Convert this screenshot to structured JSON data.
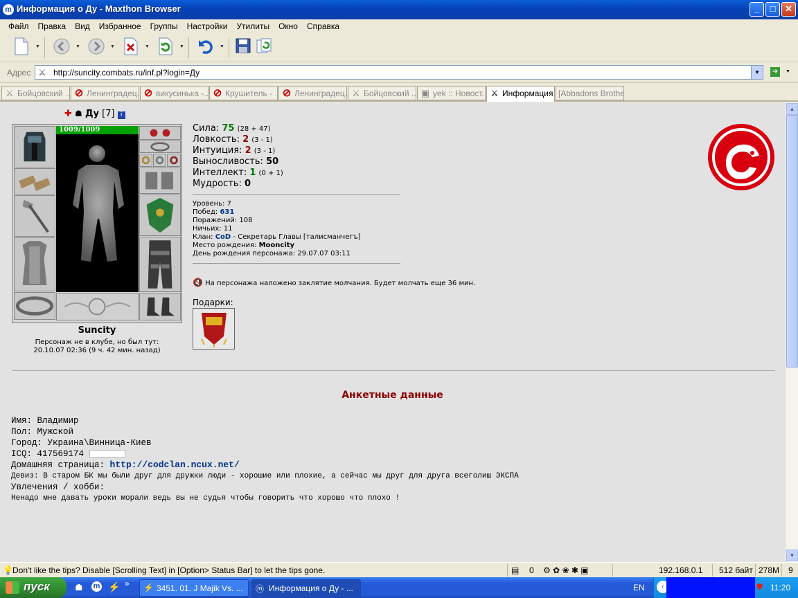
{
  "window": {
    "title": "Информация о Ду - Maxthon Browser",
    "buttons": {
      "minimize": "_",
      "maximize": "□",
      "close": "✕"
    }
  },
  "menu": [
    "Файл",
    "Правка",
    "Вид",
    "Избранное",
    "Группы",
    "Настройки",
    "Утилиты",
    "Окно",
    "Справка"
  ],
  "toolbar": {
    "icons": [
      "new-page-icon",
      "back-icon",
      "forward-icon",
      "stop-icon",
      "refresh-icon",
      "undo-icon",
      "save-icon",
      "sync-icon"
    ]
  },
  "address": {
    "label": "Адрес",
    "url": "http://suncity.combats.ru/inf.pl?login=Ду"
  },
  "tabs": [
    {
      "label": "Бойцовский ...",
      "icon": "swords-icon"
    },
    {
      "label": "Ленинградец...",
      "icon": "no-entry-icon"
    },
    {
      "label": "викусинька -...",
      "icon": "no-entry-icon"
    },
    {
      "label": "Крушитель - ...",
      "icon": "no-entry-icon"
    },
    {
      "label": "Ленинградец...",
      "icon": "no-entry-icon"
    },
    {
      "label": "Бойцовский ...",
      "icon": "swords-icon"
    },
    {
      "label": "yek :: Новост...",
      "icon": "page-icon"
    },
    {
      "label": "Информация...",
      "icon": "swords-icon",
      "active": true
    },
    {
      "label": "[Abbadons Brothe...",
      "icon": "none"
    }
  ],
  "profile": {
    "name": "Ду",
    "level_badge": "[7]",
    "hp": "1009/1009",
    "hp_fraction": 1.0,
    "city": "Suncity",
    "last_seen_line1": "Персонаж не в клубе, но был тут:",
    "last_seen_line2": "20.10.07 02:36 (9 ч. 42 мин. назад)",
    "stats": [
      {
        "label": "Сила:",
        "value": "75",
        "detail": "(28 + 47)",
        "color": "#007700"
      },
      {
        "label": "Ловкость:",
        "value": "2",
        "detail": "(3 - 1)",
        "color": "#8b0000"
      },
      {
        "label": "Интуиция:",
        "value": "2",
        "detail": "(3 - 1)",
        "color": "#8b0000"
      },
      {
        "label": "Выносливость:",
        "value": "50",
        "detail": "",
        "color": "#000000"
      },
      {
        "label": "Интеллект:",
        "value": "1",
        "detail": "(0 + 1)",
        "color": "#007700"
      },
      {
        "label": "Мудрость:",
        "value": "0",
        "detail": "",
        "color": "#000000"
      }
    ],
    "info": {
      "level_label": "Уровень:",
      "level": "7",
      "wins_label": "Побед:",
      "wins": "631",
      "losses_label": "Поражений:",
      "losses": "108",
      "draws_label": "Ничьих:",
      "draws": "11",
      "clan_label": "Клан:",
      "clan": "CoD",
      "clan_role": "- Секретарь Главы [талисманчегъ]",
      "birthplace_label": "Место рождения:",
      "birthplace": "Mooncity",
      "birthday_label": "День рождения персонажа:",
      "birthday": "29.07.07 03:11"
    },
    "silence_notice": "На персонажа наложено заклятие молчания. Будет молчать еще 36 мин.",
    "gifts_label": "Подарки:"
  },
  "questionnaire": {
    "heading": "Анкетные данные",
    "name": "Имя: Владимир",
    "gender": "Пол: Мужской",
    "city": "Город: Украина\\Винница-Киев",
    "icq": "ICQ: 417569174",
    "homepage_label": "Домашняя страница:",
    "homepage": "http://codclan.ncux.net/",
    "motto": "Девиз: В старом БК мы были друг для дружки люди - хорошие или плохие, а сейчас мы друг для друга всеголиш ЭКСПА",
    "hobbies_label": "Увлечения / хобби:",
    "hobbies": "Ненадо мне давать уроки морали ведь вы не судья чтобы говорить что хорошо что плохо !"
  },
  "status": {
    "tip": "Don't like the tips? Disable [Scrolling Text] in [Option> Status Bar] to let the tips gone.",
    "count": "0",
    "ip": "192.168.0.1",
    "bytes": "512 байт",
    "memory": "278M",
    "tabs_count": "9"
  },
  "taskbar": {
    "start": "пуск",
    "items": [
      {
        "label": "3451. 01. J Majik Vs. ..."
      },
      {
        "label": "Информация о Ду - ...",
        "active": true
      }
    ],
    "lang": "EN",
    "clock": "11:20"
  },
  "colors": {
    "link_blue": "#003388",
    "heading_red": "#8b0000",
    "hp_green": "#00a000",
    "emblem_red": "#d8000f"
  }
}
